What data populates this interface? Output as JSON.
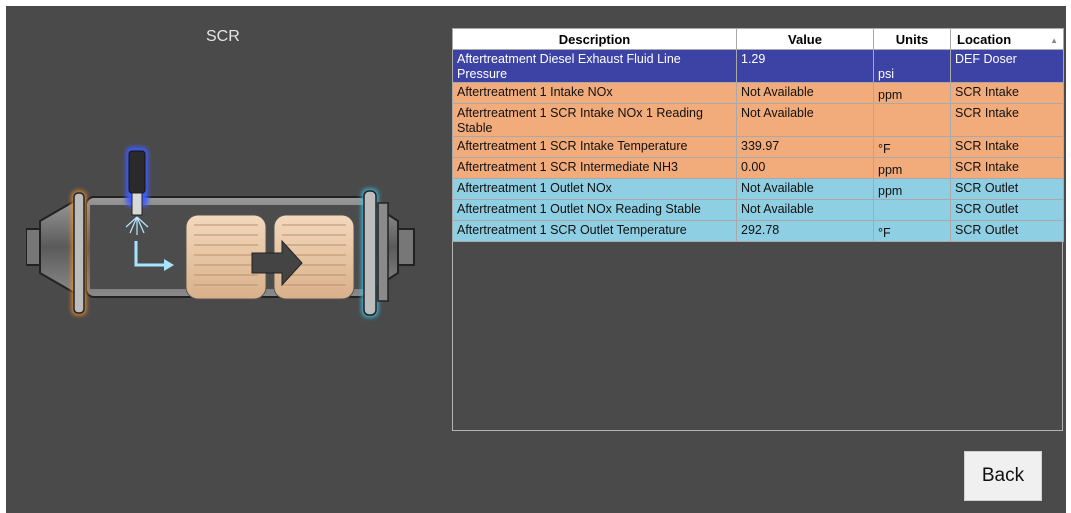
{
  "screen": {
    "title": "SCR"
  },
  "table": {
    "headers": {
      "description": "Description",
      "value": "Value",
      "units": "Units",
      "location": "Location"
    },
    "rows": [
      {
        "description": "Aftertreatment Diesel Exhaust Fluid Line Pressure",
        "value": "1.29",
        "units": "psi",
        "location": "DEF Doser",
        "group": "doser"
      },
      {
        "description": "Aftertreatment 1 Intake NOx",
        "value": "Not Available",
        "units": "ppm",
        "location": "SCR Intake",
        "group": "intake"
      },
      {
        "description": "Aftertreatment 1 SCR Intake NOx 1 Reading Stable",
        "value": "Not Available",
        "units": "",
        "location": "SCR Intake",
        "group": "intake"
      },
      {
        "description": "Aftertreatment 1 SCR Intake Temperature",
        "value": "339.97",
        "units": "°F",
        "location": "SCR Intake",
        "group": "intake"
      },
      {
        "description": "Aftertreatment 1 SCR Intermediate NH3",
        "value": "0.00",
        "units": "ppm",
        "location": "SCR Intake",
        "group": "intake"
      },
      {
        "description": "Aftertreatment 1 Outlet NOx",
        "value": "Not Available",
        "units": "ppm",
        "location": "SCR Outlet",
        "group": "outlet"
      },
      {
        "description": "Aftertreatment 1 Outlet NOx Reading Stable",
        "value": "Not Available",
        "units": "",
        "location": "SCR Outlet",
        "group": "outlet"
      },
      {
        "description": "Aftertreatment 1 SCR Outlet Temperature",
        "value": "292.78",
        "units": "°F",
        "location": "SCR Outlet",
        "group": "outlet"
      }
    ]
  },
  "buttons": {
    "back": "Back"
  },
  "colors": {
    "background": "#4a4a4a",
    "doser_row": "#3d43a4",
    "intake_row": "#f2ab7a",
    "outlet_row": "#8fcfe3",
    "intake_glow": "#f08a2c",
    "outlet_glow": "#38c3ee",
    "injector_glow": "#3c5cff"
  },
  "icons": {
    "sort": "sort-indicator-icon",
    "diagram": "scr-catalyst-diagram",
    "flow_arrow": "flow-arrow-icon",
    "def_arrow": "def-spray-arrow-icon"
  }
}
